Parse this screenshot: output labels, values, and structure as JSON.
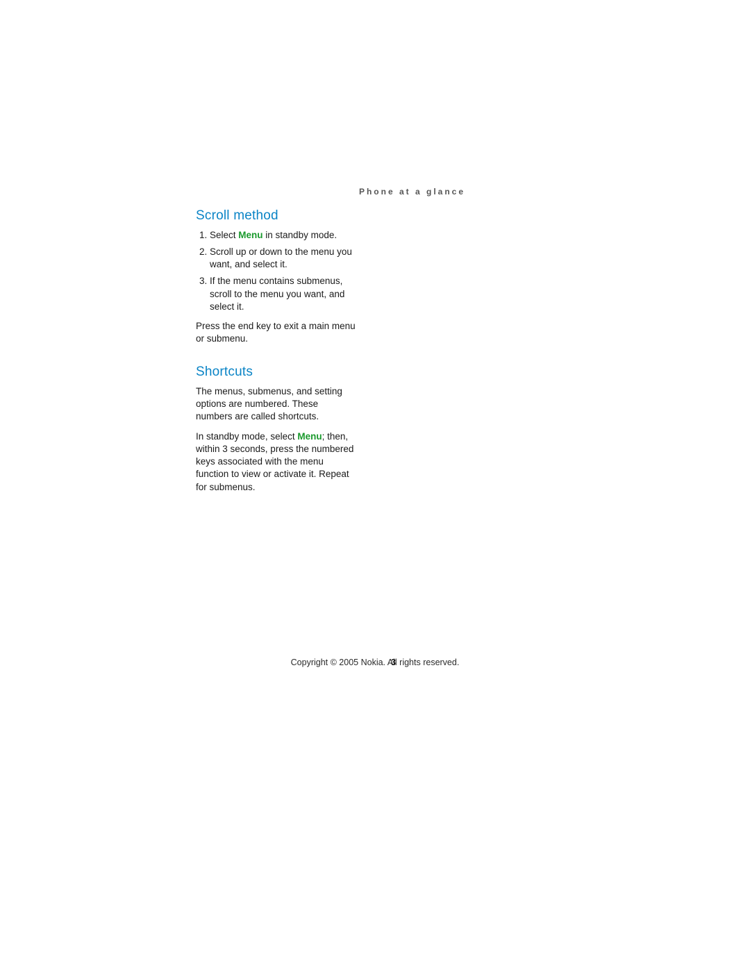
{
  "header": {
    "running_head": "Phone at a glance"
  },
  "sections": {
    "scroll": {
      "title": "Scroll method",
      "step1_pre": "Select ",
      "step1_kw": "Menu",
      "step1_post": " in standby mode.",
      "step2": "Scroll up or down to the menu you want, and select it.",
      "step3": "If the menu contains submenus, scroll to the menu you want, and select it.",
      "note": "Press the end key to exit a main menu or submenu."
    },
    "shortcuts": {
      "title": "Shortcuts",
      "p1": "The menus, submenus, and setting options are numbered. These numbers are called shortcuts.",
      "p2_pre": "In standby mode, select ",
      "p2_kw": "Menu",
      "p2_post": "; then, within 3 seconds, press the numbered keys associated with the menu function to view or activate it. Repeat for submenus."
    }
  },
  "footer": {
    "copyright": "Copyright © 2005 Nokia. All rights reserved.",
    "page_number": "3"
  }
}
